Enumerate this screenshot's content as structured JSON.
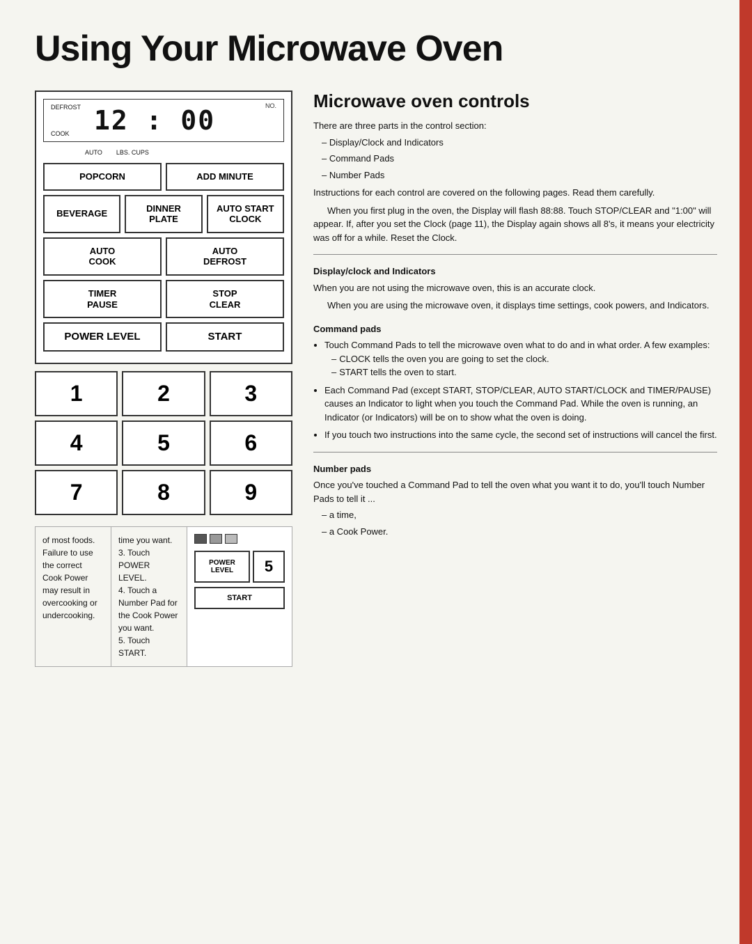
{
  "page": {
    "title": "Using Your Microwave Oven"
  },
  "right_section": {
    "heading": "Microwave oven controls",
    "intro_paragraphs": [
      "There are three parts in the control section:"
    ],
    "dash_items": [
      "Display/Clock and Indicators",
      "Command Pads",
      "Number Pads"
    ],
    "instructions": "Instructions for each control are covered on the following pages. Read them carefully.",
    "plug_text": "When you first plug in the oven, the Display will flash 88:88. Touch STOP/CLEAR and \"1:00\" will appear. If, after you set the Clock (page 11), the Display again shows all 8's, it means your electricity was off for a while. Reset the Clock.",
    "display_clock_heading": "Display/clock and Indicators",
    "display_clock_p1": "When you are not using the microwave oven, this is an accurate clock.",
    "display_clock_p2": "When you are using the microwave oven, it displays time settings, cook powers, and Indicators.",
    "command_pads_heading": "Command pads",
    "command_bullets": [
      {
        "text": "Touch Command Pads to tell the microwave oven what to do and in what order. A few examples:",
        "sub": [
          "CLOCK tells the oven you are going to set the clock.",
          "START tells the oven to start."
        ]
      },
      {
        "text": "Each Command Pad (except START, STOP/CLEAR, AUTO START/CLOCK and TIMER/PAUSE) causes an Indicator to light when you touch the Command Pad. While the oven is running, an Indicator (or Indicators) will be on to show what the oven is doing.",
        "sub": []
      },
      {
        "text": "If you touch two instructions into the same cycle, the second set of instructions will cancel the first.",
        "sub": []
      }
    ],
    "number_pads_heading": "Number pads",
    "number_pads_p": "Once you've touched a Command Pad to tell the oven what you want it to do, you'll touch Number Pads to tell it ...",
    "number_dash_items": [
      "a time,",
      "a Cook Power."
    ]
  },
  "display": {
    "label_no": "NO.",
    "label_defrost": "DEFROST",
    "label_cook": "COOK",
    "clock": "12 : 00",
    "bottom_labels": [
      "AUTO",
      "LBS. CUPS"
    ]
  },
  "buttons": {
    "popcorn": "POPCORN",
    "add_minute": "ADD MINUTE",
    "beverage": "BEVERAGE",
    "dinner_plate": "DINNER\nPLATE",
    "auto_start_clock": "AUTO START\nCLOCK",
    "auto_cook": "AUTO\nCOOK",
    "auto_defrost": "AUTO\nDEFROST",
    "timer_pause": "TIMER\nPAUSE",
    "stop_clear": "STOP\nCLEAR",
    "power_level": "POWER LEVEL",
    "start": "START"
  },
  "number_pads": [
    "1",
    "2",
    "3",
    "4",
    "5",
    "6",
    "7",
    "8",
    "9"
  ],
  "bottom": {
    "left_text": "of most foods. Failure to use the correct Cook Power may result in overcooking or undercooking.",
    "steps": [
      "time you want.",
      "Touch POWER LEVEL.",
      "Touch a Number Pad for the Cook Power you want.",
      "Touch START."
    ],
    "steps_prefix": [
      "3.",
      "4.",
      "5."
    ],
    "mini_buttons": {
      "power_level": "POWER LEVEL",
      "number": "5",
      "start": "START"
    }
  }
}
